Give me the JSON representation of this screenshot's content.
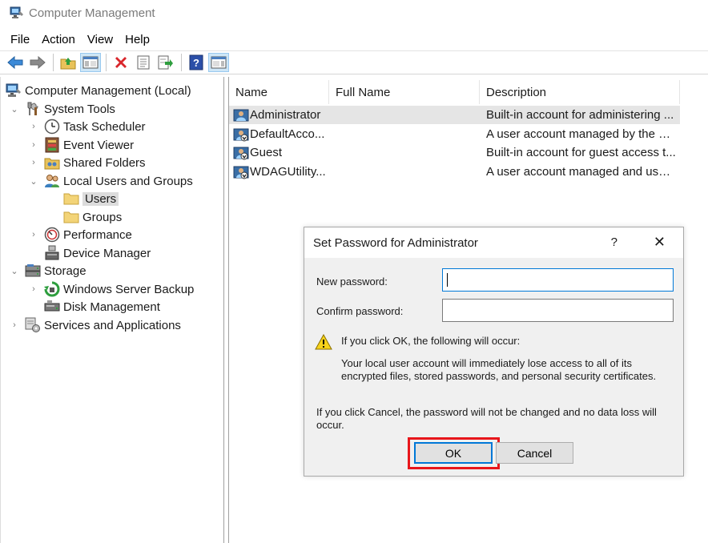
{
  "window": {
    "title": "Computer Management"
  },
  "menu": [
    "File",
    "Action",
    "View",
    "Help"
  ],
  "toolbar": {
    "buttons": [
      "back-arrow-icon",
      "forward-arrow-icon",
      "up-folder-icon",
      "show-hide-tree-icon",
      "delete-icon",
      "properties-icon",
      "export-list-icon",
      "help-icon",
      "show-hide-action-pane-icon"
    ]
  },
  "tree": {
    "items": [
      {
        "label": "Computer Management (Local)",
        "icon": "computer-management-icon"
      },
      {
        "label": "System Tools",
        "icon": "tools-icon"
      },
      {
        "label": "Task Scheduler",
        "icon": "clock-icon"
      },
      {
        "label": "Event Viewer",
        "icon": "event-viewer-icon"
      },
      {
        "label": "Shared Folders",
        "icon": "shared-folder-icon"
      },
      {
        "label": "Local Users and Groups",
        "icon": "users-group-icon"
      },
      {
        "label": "Users",
        "icon": "folder-icon"
      },
      {
        "label": "Groups",
        "icon": "folder-icon"
      },
      {
        "label": "Performance",
        "icon": "performance-icon"
      },
      {
        "label": "Device Manager",
        "icon": "device-manager-icon"
      },
      {
        "label": "Storage",
        "icon": "storage-icon"
      },
      {
        "label": "Windows Server Backup",
        "icon": "backup-icon"
      },
      {
        "label": "Disk Management",
        "icon": "disk-icon"
      },
      {
        "label": "Services and Applications",
        "icon": "services-icon"
      }
    ]
  },
  "list": {
    "columns": [
      "Name",
      "Full Name",
      "Description"
    ],
    "rows": [
      {
        "name": "Administrator",
        "full_name": "",
        "description": "Built-in account for administering ..."
      },
      {
        "name": "DefaultAcco...",
        "full_name": "",
        "description": "A user account managed by the sy..."
      },
      {
        "name": "Guest",
        "full_name": "",
        "description": "Built-in account for guest access t..."
      },
      {
        "name": "WDAGUtility...",
        "full_name": "",
        "description": "A user account managed and used..."
      }
    ]
  },
  "dialog": {
    "title": "Set Password for Administrator",
    "help": "?",
    "close": "✕",
    "new_password_label": "New password:",
    "new_password_value": "",
    "confirm_password_label": "Confirm password:",
    "confirm_password_value": "",
    "warning_heading": "If you click OK, the following will occur:",
    "warning_line1": "Your local user account will immediately lose access to all of its",
    "warning_line2": "encrypted files, stored passwords, and personal security certificates.",
    "cancel_note_line1": "If you click Cancel, the password will not be changed and no data loss will",
    "cancel_note_line2": "occur.",
    "ok_label": "OK",
    "cancel_label": "Cancel"
  },
  "colors": {
    "accent": "#0078d7",
    "highlight": "#e8161b",
    "selection": "#dcdcdc",
    "dialog_bg": "#f0f0f0"
  }
}
